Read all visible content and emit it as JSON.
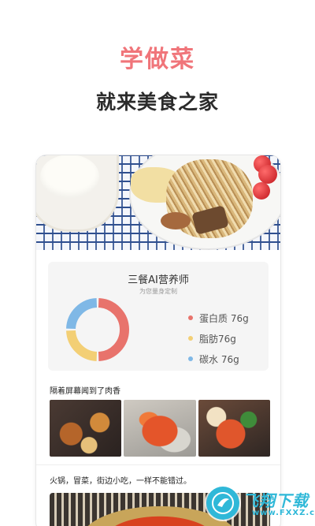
{
  "headline": "学做菜",
  "subheadline": "就来美食之家",
  "nutrition": {
    "title": "三餐AI营养师",
    "subtitle": "为您量身定制",
    "legend": [
      {
        "label": "蛋白质 76g",
        "color": "#e8736c",
        "share": 0.5
      },
      {
        "label": "脂肪76g",
        "color": "#f3cf75",
        "share": 0.25
      },
      {
        "label": "碳水 76g",
        "color": "#7fb8e6",
        "share": 0.25
      }
    ]
  },
  "sections": {
    "meat_title": "隔着屏幕闻到了肉香",
    "hotpot_title": "火锅，冒菜，街边小吃，一样不能错过。"
  },
  "watermark": {
    "brand": "飞翔下载",
    "url": "www.FXXZ.com"
  }
}
